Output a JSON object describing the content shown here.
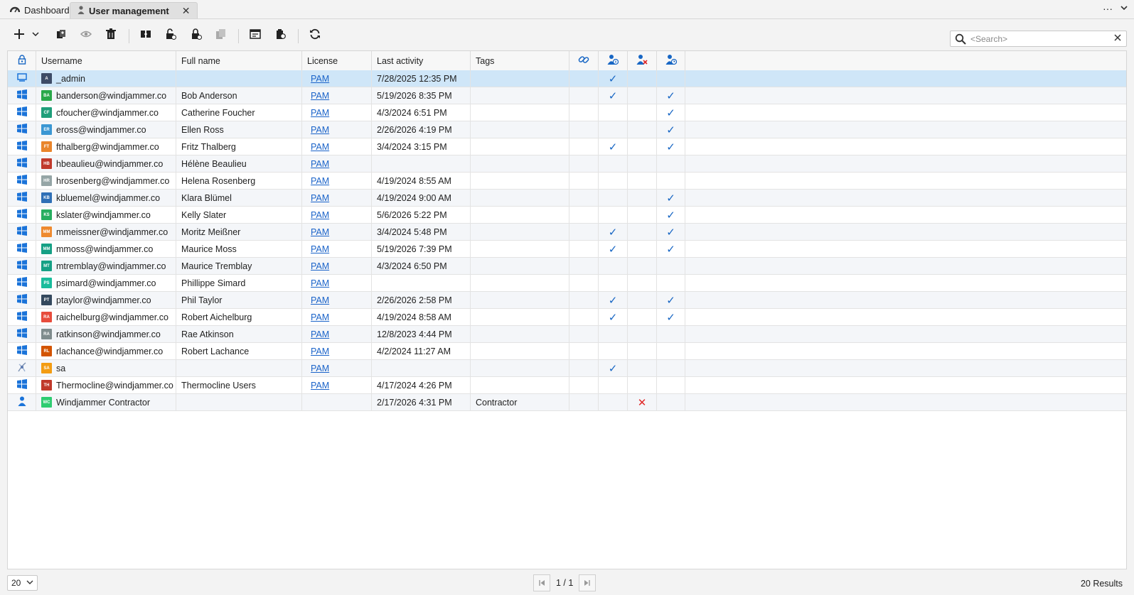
{
  "tabs": [
    {
      "label": "Dashboard",
      "icon": "dashboard-icon",
      "active": false
    },
    {
      "label": "User management",
      "icon": "user-icon",
      "active": true
    }
  ],
  "tabbar_menu": "···",
  "search": {
    "placeholder": "<Search>"
  },
  "columns": {
    "username": "Username",
    "fullname": "Full name",
    "license": "License",
    "last_activity": "Last activity",
    "tags": "Tags"
  },
  "rows": [
    {
      "type": "console",
      "initials": "A",
      "color": "#3d4b66",
      "username": "_admin",
      "fullname": "",
      "license": "PAM",
      "last": "7/28/2025 12:35 PM",
      "tags": "",
      "c2": true,
      "c3": false,
      "c4": false,
      "selected": true
    },
    {
      "type": "windows",
      "initials": "BA",
      "color": "#2aa84a",
      "username": "banderson@windjammer.co",
      "fullname": "Bob Anderson",
      "license": "PAM",
      "last": "5/19/2026 8:35 PM",
      "tags": "",
      "c2": true,
      "c3": false,
      "c4": true
    },
    {
      "type": "windows",
      "initials": "CF",
      "color": "#1f9e7a",
      "username": "cfoucher@windjammer.co",
      "fullname": "Catherine Foucher",
      "license": "PAM",
      "last": "4/3/2024 6:51 PM",
      "tags": "",
      "c2": false,
      "c3": false,
      "c4": true
    },
    {
      "type": "windows",
      "initials": "ER",
      "color": "#3b97d3",
      "username": "eross@windjammer.co",
      "fullname": "Ellen Ross",
      "license": "PAM",
      "last": "2/26/2026 4:19 PM",
      "tags": "",
      "c2": false,
      "c3": false,
      "c4": true
    },
    {
      "type": "windows",
      "initials": "FT",
      "color": "#e9852b",
      "username": "fthalberg@windjammer.co",
      "fullname": "Fritz Thalberg",
      "license": "PAM",
      "last": "3/4/2024 3:15 PM",
      "tags": "",
      "c2": true,
      "c3": false,
      "c4": true
    },
    {
      "type": "windows",
      "initials": "HB",
      "color": "#c0392b",
      "username": "hbeaulieu@windjammer.co",
      "fullname": "Hélène Beaulieu",
      "license": "PAM",
      "last": "",
      "tags": "",
      "c2": false,
      "c3": false,
      "c4": false
    },
    {
      "type": "windows",
      "initials": "HR",
      "color": "#95a5a6",
      "username": "hrosenberg@windjammer.co",
      "fullname": "Helena Rosenberg",
      "license": "PAM",
      "last": "4/19/2024 8:55 AM",
      "tags": "",
      "c2": false,
      "c3": false,
      "c4": false
    },
    {
      "type": "windows",
      "initials": "KB",
      "color": "#2f6fb6",
      "username": "kbluemel@windjammer.co",
      "fullname": "Klara Blümel",
      "license": "PAM",
      "last": "4/19/2024 9:00 AM",
      "tags": "",
      "c2": false,
      "c3": false,
      "c4": true
    },
    {
      "type": "windows",
      "initials": "KS",
      "color": "#27ae60",
      "username": "kslater@windjammer.co",
      "fullname": "Kelly Slater",
      "license": "PAM",
      "last": "5/6/2026 5:22 PM",
      "tags": "",
      "c2": false,
      "c3": false,
      "c4": true
    },
    {
      "type": "windows",
      "initials": "MM",
      "color": "#ee8a2f",
      "username": "mmeissner@windjammer.co",
      "fullname": "Moritz Meißner",
      "license": "PAM",
      "last": "3/4/2024 5:48 PM",
      "tags": "",
      "c2": true,
      "c3": false,
      "c4": true
    },
    {
      "type": "windows",
      "initials": "MM",
      "color": "#16a085",
      "username": "mmoss@windjammer.co",
      "fullname": "Maurice Moss",
      "license": "PAM",
      "last": "5/19/2026 7:39 PM",
      "tags": "",
      "c2": true,
      "c3": false,
      "c4": true
    },
    {
      "type": "windows",
      "initials": "MT",
      "color": "#16a085",
      "username": "mtremblay@windjammer.co",
      "fullname": "Maurice Tremblay",
      "license": "PAM",
      "last": "4/3/2024 6:50 PM",
      "tags": "",
      "c2": false,
      "c3": false,
      "c4": false
    },
    {
      "type": "windows",
      "initials": "PS",
      "color": "#1abc9c",
      "username": "psimard@windjammer.co",
      "fullname": "Phillippe Simard",
      "license": "PAM",
      "last": "",
      "tags": "",
      "c2": false,
      "c3": false,
      "c4": false
    },
    {
      "type": "windows",
      "initials": "PT",
      "color": "#34495e",
      "username": "ptaylor@windjammer.co",
      "fullname": "Phil Taylor",
      "license": "PAM",
      "last": "2/26/2026 2:58 PM",
      "tags": "",
      "c2": true,
      "c3": false,
      "c4": true
    },
    {
      "type": "windows",
      "initials": "RA",
      "color": "#e74c3c",
      "username": "raichelburg@windjammer.co",
      "fullname": "Robert Aichelburg",
      "license": "PAM",
      "last": "4/19/2024 8:58 AM",
      "tags": "",
      "c2": true,
      "c3": false,
      "c4": true
    },
    {
      "type": "windows",
      "initials": "RA",
      "color": "#7f8c8d",
      "username": "ratkinson@windjammer.co",
      "fullname": "Rae Atkinson",
      "license": "PAM",
      "last": "12/8/2023 4:44 PM",
      "tags": "",
      "c2": false,
      "c3": false,
      "c4": false
    },
    {
      "type": "windows",
      "initials": "RL",
      "color": "#d35400",
      "username": "rlachance@windjammer.co",
      "fullname": "Robert Lachance",
      "license": "PAM",
      "last": "4/2/2024 11:27 AM",
      "tags": "",
      "c2": false,
      "c3": false,
      "c4": false
    },
    {
      "type": "sql",
      "initials": "SA",
      "color": "#f39c12",
      "username": "sa",
      "fullname": "",
      "license": "PAM",
      "last": "",
      "tags": "",
      "c2": true,
      "c3": false,
      "c4": false
    },
    {
      "type": "windows",
      "initials": "TH",
      "color": "#c0392b",
      "username": "Thermocline@windjammer.co",
      "fullname": "Thermocline Users",
      "license": "PAM",
      "last": "4/17/2024 4:26 PM",
      "tags": "",
      "c2": false,
      "c3": false,
      "c4": false
    },
    {
      "type": "person",
      "initials": "WC",
      "color": "#2ecc71",
      "username": "Windjammer Contractor",
      "fullname": "",
      "license": "",
      "last": "2/17/2026 4:31 PM",
      "tags": "Contractor",
      "c2": false,
      "c3": true,
      "c4": false
    }
  ],
  "footer": {
    "page_size": "20",
    "page_indicator": "1 / 1",
    "results": "20 Results"
  }
}
